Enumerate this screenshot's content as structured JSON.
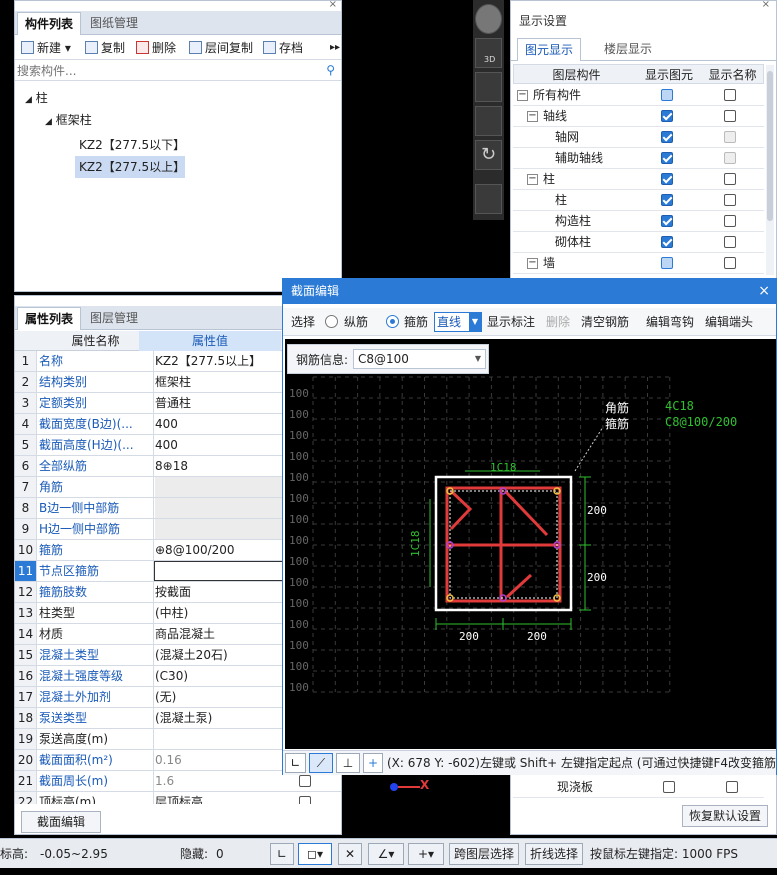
{
  "component_panel": {
    "tabs": [
      "构件列表",
      "图纸管理"
    ],
    "toolbar": [
      "新建",
      "复制",
      "删除",
      "层间复制",
      "存档"
    ],
    "search_placeholder": "搜索构件...",
    "tree": {
      "root": "柱",
      "child": "框架柱",
      "items": [
        "KZ2【277.5以下】",
        "KZ2【277.5以上】"
      ]
    }
  },
  "property_panel": {
    "tabs": [
      "属性列表",
      "图层管理"
    ],
    "headers": [
      "属性名称",
      "属性值"
    ],
    "rows": [
      {
        "n": "1",
        "name": "名称",
        "value": "KZ2【277.5以上】"
      },
      {
        "n": "2",
        "name": "结构类别",
        "value": "框架柱"
      },
      {
        "n": "3",
        "name": "定额类别",
        "value": "普通柱"
      },
      {
        "n": "4",
        "name": "截面宽度(B边)(...",
        "value": "400"
      },
      {
        "n": "5",
        "name": "截面高度(H边)(...",
        "value": "400"
      },
      {
        "n": "6",
        "name": "全部纵筋",
        "value": "8⊕18"
      },
      {
        "n": "7",
        "name": "角筋",
        "value": ""
      },
      {
        "n": "8",
        "name": "B边一侧中部筋",
        "value": ""
      },
      {
        "n": "9",
        "name": "H边一侧中部筋",
        "value": ""
      },
      {
        "n": "10",
        "name": "箍筋",
        "value": "⊕8@100/200"
      },
      {
        "n": "11",
        "name": "节点区箍筋",
        "value": ""
      },
      {
        "n": "12",
        "name": "箍筋肢数",
        "value": "按截面"
      },
      {
        "n": "13",
        "name": "柱类型",
        "value": "(中柱)"
      },
      {
        "n": "14",
        "name": "材质",
        "value": "商品混凝土"
      },
      {
        "n": "15",
        "name": "混凝土类型",
        "value": "(混凝土20石)"
      },
      {
        "n": "16",
        "name": "混凝土强度等级",
        "value": "(C30)"
      },
      {
        "n": "17",
        "name": "混凝土外加剂",
        "value": "(无)"
      },
      {
        "n": "18",
        "name": "泵送类型",
        "value": "(混凝土泵)"
      },
      {
        "n": "19",
        "name": "泵送高度(m)",
        "value": ""
      },
      {
        "n": "20",
        "name": "截面面积(m²)",
        "value": "0.16"
      },
      {
        "n": "21",
        "name": "截面周长(m)",
        "value": "1.6"
      },
      {
        "n": "22",
        "name": "顶标高(m)",
        "value": "层顶标高"
      }
    ],
    "bottom_button": "截面编辑"
  },
  "display_panel": {
    "title": "显示设置",
    "tabs": [
      "图元显示",
      "楼层显示"
    ],
    "headers": [
      "图层构件",
      "显示图元",
      "显示名称"
    ],
    "rows": [
      {
        "label": "所有构件",
        "level": 0,
        "toggle": "−",
        "show": "part",
        "name": "off"
      },
      {
        "label": "轴线",
        "level": 1,
        "toggle": "−",
        "show": "on",
        "name": "off"
      },
      {
        "label": "轴网",
        "level": 2,
        "toggle": "",
        "show": "on",
        "name": "dis"
      },
      {
        "label": "辅助轴线",
        "level": 2,
        "toggle": "",
        "show": "on",
        "name": "dis"
      },
      {
        "label": "柱",
        "level": 1,
        "toggle": "−",
        "show": "on",
        "name": "off"
      },
      {
        "label": "柱",
        "level": 2,
        "toggle": "",
        "show": "on",
        "name": "off"
      },
      {
        "label": "构造柱",
        "level": 2,
        "toggle": "",
        "show": "on",
        "name": "off"
      },
      {
        "label": "砌体柱",
        "level": 2,
        "toggle": "",
        "show": "on",
        "name": "off"
      },
      {
        "label": "墙",
        "level": 1,
        "toggle": "−",
        "show": "part",
        "name": "off"
      }
    ],
    "bottom_row": "现浇板",
    "restore_button": "恢复默认设置"
  },
  "section_dialog": {
    "title": "截面编辑",
    "close": "×",
    "select_label": "选择",
    "radio_long": "纵筋",
    "radio_stirrup": "箍筋",
    "line_mode": "直线",
    "show_label": "显示标注",
    "delete": "删除",
    "clear": "清空钢筋",
    "edit_hook": "编辑弯钩",
    "edit_end": "编辑端头",
    "rebar_info_label": "钢筋信息:",
    "rebar_info_value": "C8@100",
    "grid_label": "100",
    "legend_corner": "角筋",
    "legend_corner_val": "4C18",
    "legend_stirrup": "箍筋",
    "legend_stirrup_val": "C8@100/200",
    "top_label": "1C18",
    "left_label": "1C18",
    "dim_right_top": "200",
    "dim_right_bottom": "200",
    "dim_bottom_left": "200",
    "dim_bottom_right": "200",
    "status_text": "(X: 678 Y: -602)左键或 Shift+ 左键指定起点 (可通过快捷键F4改变箍筋"
  },
  "status_bar": {
    "elevation": "标高:",
    "elevation_value": "-0.05~2.95",
    "hidden": "隐藏:",
    "hidden_value": "0",
    "btn_cross_layer": "跨图层选择",
    "btn_polyline": "折线选择",
    "hint": "按鼠标左键指定: 1000 FPS"
  },
  "colors": {
    "accent": "#2a7ad6",
    "rebar": "#e03a3a",
    "dim": "#30c030"
  }
}
